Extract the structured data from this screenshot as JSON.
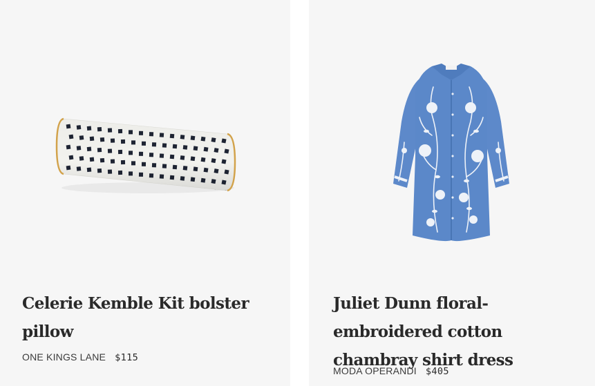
{
  "products": [
    {
      "title": "Celerie Kemble Kit bolster pillow",
      "retailer": "ONE KINGS LANE",
      "price": "$115",
      "image": "bolster-pillow-image"
    },
    {
      "title": "Juliet Dunn floral-embroidered cotton chambray shirt dress",
      "retailer": "MODA OPERANDI",
      "price": "$405",
      "image": "shirt-dress-image"
    }
  ],
  "colors": {
    "card_bg": "#f6f6f6",
    "pillow_base": "#f2f2ee",
    "pillow_dots": "#1e2433",
    "pillow_piping": "#d2a24a",
    "dress_blue": "#5b88c9",
    "dress_embroidery": "#eef2f8"
  }
}
